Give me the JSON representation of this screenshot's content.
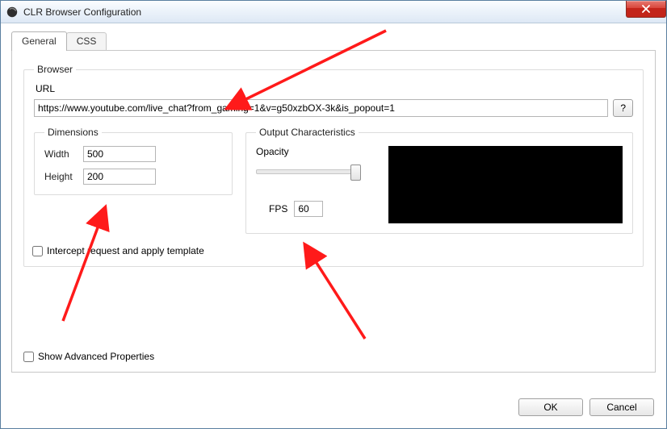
{
  "window": {
    "title": "CLR Browser Configuration"
  },
  "tabs": {
    "general": "General",
    "css": "CSS"
  },
  "browser": {
    "legend": "Browser",
    "url_label": "URL",
    "url_value": "https://www.youtube.com/live_chat?from_gaming=1&v=g50xzbOX-3k&is_popout=1",
    "help_button": "?"
  },
  "dimensions": {
    "legend": "Dimensions",
    "width_label": "Width",
    "width_value": "500",
    "height_label": "Height",
    "height_value": "200"
  },
  "intercept_label": "Intercept request and apply template",
  "output": {
    "legend": "Output Characteristics",
    "opacity_label": "Opacity",
    "opacity_percent": 100,
    "fps_label": "FPS",
    "fps_value": "60"
  },
  "advanced_label": "Show Advanced Properties",
  "buttons": {
    "ok": "OK",
    "cancel": "Cancel"
  }
}
